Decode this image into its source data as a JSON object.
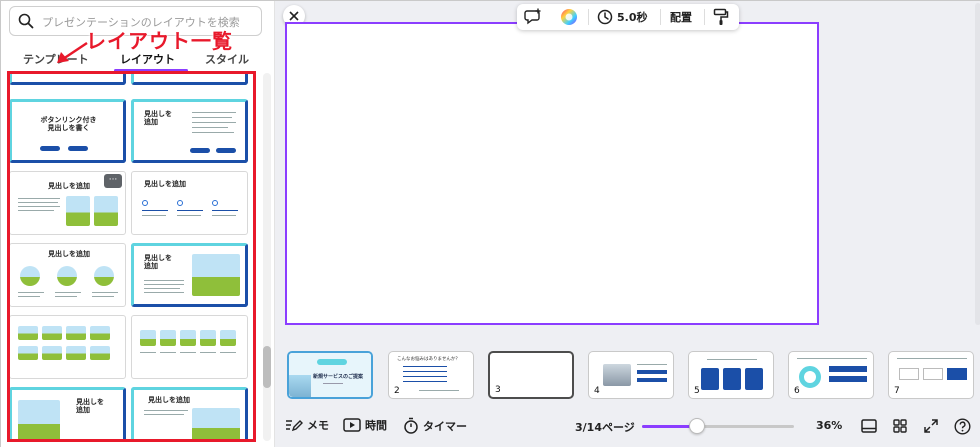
{
  "left_panel": {
    "search": {
      "placeholder": "プレゼンテーションのレイアウトを検索"
    },
    "tabs": [
      {
        "label": "テンプレート"
      },
      {
        "label": "レイアウト",
        "active": true
      },
      {
        "label": "スタイル"
      }
    ],
    "annotation": {
      "label": "レイアウト一覧",
      "color": "#e8192b"
    },
    "thumbnails": {
      "r1": {
        "title": "ボタンリンク付き\n見出しを書く",
        "pill_a": "ボタン",
        "pill_b": "ボタン"
      },
      "r1b": {
        "title": "見出しを\n追加"
      },
      "r2": {
        "title": "見出しを追加"
      },
      "r2b": {
        "title": "見出しを追加"
      },
      "r3": {
        "title": "見出しを追加"
      },
      "r3b": {
        "title": "見出しを\n追加"
      },
      "r5": {
        "title": "見出しを\n追加"
      },
      "r5b": {
        "title": "見出しを追加"
      },
      "more_icon": "more-horizontal-icon"
    }
  },
  "toolbar": {
    "duration": "5.0秒",
    "arrange": "配置"
  },
  "slides": [
    {
      "num": "",
      "title": "新規サービスのご提案"
    },
    {
      "num": "2",
      "title": "こんなお悩みはありませんか？"
    },
    {
      "num": "3"
    },
    {
      "num": "4"
    },
    {
      "num": "5"
    },
    {
      "num": "6"
    },
    {
      "num": "7"
    }
  ],
  "bottom": {
    "notes": "メモ",
    "time": "時間",
    "timer": "タイマー",
    "page": "3/14ページ",
    "zoom_label": "36%",
    "zoom_value": 0.36
  },
  "colors": {
    "accent": "#8b3dff",
    "frame": "#e8192b",
    "brand_blue": "#1b4fa8",
    "cyan": "#5fd4e0"
  }
}
